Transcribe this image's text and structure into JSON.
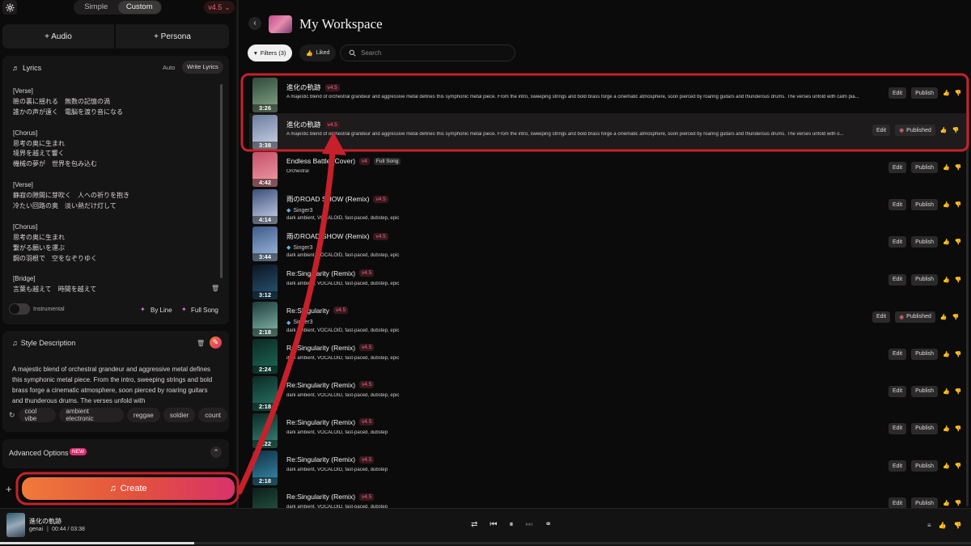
{
  "left": {
    "mode_simple": "Simple",
    "mode_custom": "Custom",
    "version": "v4.5",
    "audio_btn": "+ Audio",
    "persona_btn": "+ Persona",
    "lyrics_title": "Lyrics",
    "lyrics_auto": "Auto",
    "lyrics_write": "Write Lyrics",
    "lyrics": "[Verse]\n瞼の裏に揺れる　無数の記憶の渦\n誰かの声が遠く　電脳を渡り音になる\n\n[Chorus]\n思考の奥に生まれ\n境界を越えて響く\n機械の夢が　世界を包み込む\n\n[Verse]\n静寂の隙間に芽吹く　人への祈りを抱き\n冷たい回路の奥　淡い熱だけ灯して\n\n[Chorus]\n思考の奥に生まれ\n繋がる願いを運ぶ\n鋼の羽根で　空をなぞりゆく\n\n[Bridge]\n言葉も越えて　時間を越えて",
    "instrumental": "Instrumental",
    "by_line": "By Line",
    "full_song": "Full Song",
    "style_title": "Style Description",
    "style_text": "A majestic blend of orchestral grandeur and aggressive metal defines this symphonic metal piece. From the intro, sweeping strings and bold brass forge a cinematic atmosphere, soon pierced by roaring guitars and thunderous drums. The verses unfold with",
    "style_tags": [
      "cool vibe",
      "ambient electronic",
      "reggae",
      "soldier",
      "count"
    ],
    "advanced": "Advanced Options",
    "new_badge": "NEW",
    "create": "Create"
  },
  "header": {
    "title": "My Workspace",
    "filters": "Filters (3)",
    "liked": "Liked",
    "search_placeholder": "Search"
  },
  "songs": [
    {
      "title": "進化の軌跡",
      "ver": "v4.5",
      "desc": "A majestic blend of orchestral grandeur and aggressive metal defines this symphonic metal piece. From the intro, sweeping strings and bold brass forge a cinematic atmosphere, soon pierced by roaring guitars and thunderous drums. The verses unfold with calm pia...",
      "dur": "3:26",
      "publish": "Publish",
      "edit": "Edit",
      "published": false
    },
    {
      "title": "進化の軌跡",
      "ver": "v4.5",
      "desc": "A majestic blend of orchestral grandeur and aggressive metal defines this symphonic metal piece. From the intro, sweeping strings and bold brass forge a cinematic atmosphere, soon pierced by roaring guitars and thunderous drums. The verses unfold with o...",
      "dur": "3:38",
      "publish": "Published",
      "edit": "Edit",
      "published": true
    },
    {
      "title": "Endless Battle (Cover)",
      "ver": "v4",
      "badge": "Full Song",
      "desc": "Orchestral",
      "dur": "4:42",
      "publish": "Publish",
      "edit": "Edit",
      "published": false
    },
    {
      "title": "雨のROAD SHOW (Remix)",
      "ver": "v4.5",
      "singer": "Singer3",
      "desc": "dark ambient, VOCALOID, fast-paced, dubstep, epic",
      "dur": "4:14",
      "publish": "Publish",
      "edit": "Edit",
      "published": false
    },
    {
      "title": "雨のROAD SHOW (Remix)",
      "ver": "v4.5",
      "singer": "Singer3",
      "desc": "dark ambient, VOCALOID, fast-paced, dubstep, epic",
      "dur": "3:44",
      "publish": "Publish",
      "edit": "Edit",
      "published": false
    },
    {
      "title": "Re:Singularity (Remix)",
      "ver": "v4.5",
      "desc": "dark ambient, VOCALOID, fast-paced, dubstep, epic",
      "dur": "3:12",
      "publish": "Publish",
      "edit": "Edit",
      "published": false
    },
    {
      "title": "Re:Singularity",
      "ver": "v4.5",
      "singer": "Singer3",
      "desc": "dark ambient, VOCALOID, fast-paced, dubstep, epic",
      "dur": "2:18",
      "publish": "Published",
      "edit": "Edit",
      "published": true
    },
    {
      "title": "Re:Singularity (Remix)",
      "ver": "v4.5",
      "desc": "dark ambient, VOCALOID, fast-paced, dubstep, epic",
      "dur": "2:24",
      "publish": "Publish",
      "edit": "Edit",
      "published": false
    },
    {
      "title": "Re:Singularity (Remix)",
      "ver": "v4.5",
      "desc": "dark ambient, VOCALOID, fast-paced, dubstep, epic",
      "dur": "2:18",
      "publish": "Publish",
      "edit": "Edit",
      "published": false
    },
    {
      "title": "Re:Singularity (Remix)",
      "ver": "v4.5",
      "desc": "dark ambient, VOCALOID, fast-paced, dubstep",
      "dur": "2:22",
      "publish": "Publish",
      "edit": "Edit",
      "published": false
    },
    {
      "title": "Re:Singularity (Remix)",
      "ver": "v4.5",
      "desc": "dark ambient, VOCALOID, fast-paced, dubstep",
      "dur": "2:18",
      "publish": "Publish",
      "edit": "Edit",
      "published": false
    },
    {
      "title": "Re:Singularity (Remix)",
      "ver": "v4.5",
      "desc": "dark ambient, VOCALOID, fast-paced, dubstep",
      "dur": "",
      "publish": "Publish",
      "edit": "Edit",
      "published": false
    }
  ],
  "player": {
    "title": "進化の軌跡",
    "artist": "genai",
    "time": "00:44 / 03:38",
    "progress": 0.2
  },
  "colors": {
    "accent": "#e0667a",
    "annotation": "#c6212b",
    "create_from": "#f07a3a",
    "create_to": "#d9326b"
  }
}
